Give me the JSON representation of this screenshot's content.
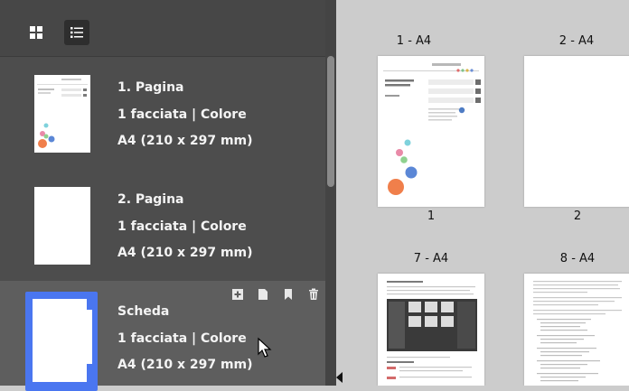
{
  "toolbar": {
    "grid_view_icon": "grid-view-icon",
    "list_view_icon": "list-view-icon",
    "active_view": "list"
  },
  "sidebar": {
    "items": [
      {
        "title": "1. Pagina",
        "sides": "1 facciata | Colore",
        "size": "A4 (210 x 297 mm)"
      },
      {
        "title": "2. Pagina",
        "sides": "1 facciata | Colore",
        "size": "A4 (210 x 297 mm)"
      },
      {
        "title": "Scheda",
        "sides": "1 facciata | Colore",
        "size": "A4 (210 x 297 mm)"
      }
    ],
    "item_actions": [
      "add-page-icon",
      "page-icon",
      "bookmark-icon",
      "trash-icon"
    ]
  },
  "canvas": {
    "pages": [
      {
        "label": "1 - A4",
        "number": "1"
      },
      {
        "label": "2 - A4",
        "number": "2"
      },
      {
        "label": "7 - A4",
        "number": ""
      },
      {
        "label": "8 - A4",
        "number": ""
      }
    ]
  },
  "colors": {
    "sidebar_bg": "#4d4d4d",
    "selected_item_bg": "#5e5e5e",
    "thumbnail_highlight": "#4a76f0",
    "canvas_bg": "#cccccc"
  }
}
